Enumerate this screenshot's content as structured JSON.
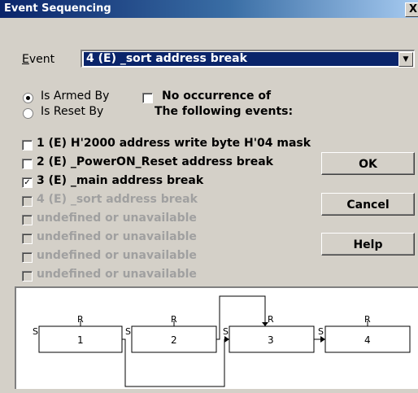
{
  "window": {
    "title": "Event Sequencing",
    "close_label": "X"
  },
  "event": {
    "label": "Event",
    "selected": "4 (E) _sort address break"
  },
  "mode": {
    "armed_label": "Is Armed By",
    "reset_label": "Is Reset By",
    "selected": "armed"
  },
  "no_occurrence": {
    "label": "No occurrence of",
    "sub": "The following events:",
    "checked": false
  },
  "events": [
    {
      "label": "1 (E) H'2000 address write byte H'04 mask",
      "checked": false,
      "enabled": true
    },
    {
      "label": "2 (E) _PowerON_Reset address break",
      "checked": false,
      "enabled": true
    },
    {
      "label": "3 (E) _main address break",
      "checked": true,
      "enabled": true
    },
    {
      "label": "4 (E) _sort address break",
      "checked": false,
      "enabled": false
    },
    {
      "label": "undefined or unavailable",
      "checked": false,
      "enabled": false
    },
    {
      "label": "undefined or unavailable",
      "checked": false,
      "enabled": false
    },
    {
      "label": "undefined or unavailable",
      "checked": false,
      "enabled": false
    },
    {
      "label": "undefined or unavailable",
      "checked": false,
      "enabled": false
    }
  ],
  "buttons": {
    "ok": "OK",
    "cancel": "Cancel",
    "help": "Help"
  },
  "diagram": {
    "set_label": "S",
    "reset_label": "R",
    "boxes": [
      "1",
      "2",
      "3",
      "4"
    ]
  }
}
